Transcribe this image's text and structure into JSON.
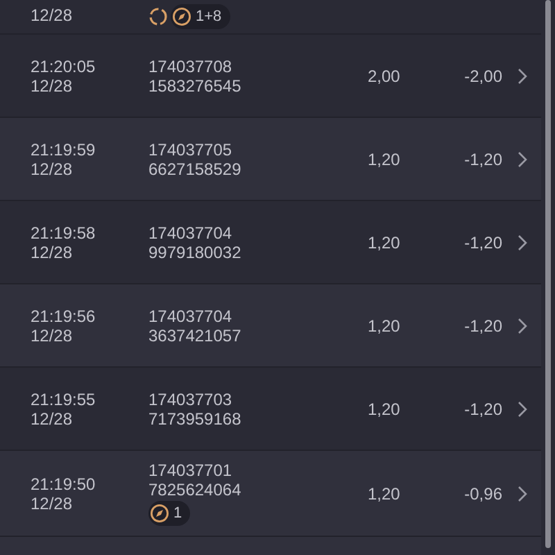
{
  "top_partial_row": {
    "date": "12/28",
    "badges": [
      {
        "kind": "refresh"
      },
      {
        "kind": "boost",
        "text": "1+8"
      }
    ]
  },
  "rows": [
    {
      "time": "21:20:05",
      "date": "12/28",
      "order_id": "174037708",
      "ticket": "1583276545",
      "amount": "2,00",
      "result": "-2,00",
      "badges": []
    },
    {
      "time": "21:19:59",
      "date": "12/28",
      "order_id": "174037705",
      "ticket": "6627158529",
      "amount": "1,20",
      "result": "-1,20",
      "badges": []
    },
    {
      "time": "21:19:58",
      "date": "12/28",
      "order_id": "174037704",
      "ticket": "9979180032",
      "amount": "1,20",
      "result": "-1,20",
      "badges": []
    },
    {
      "time": "21:19:56",
      "date": "12/28",
      "order_id": "174037704",
      "ticket": "3637421057",
      "amount": "1,20",
      "result": "-1,20",
      "badges": []
    },
    {
      "time": "21:19:55",
      "date": "12/28",
      "order_id": "174037703",
      "ticket": "7173959168",
      "amount": "1,20",
      "result": "-1,20",
      "badges": []
    },
    {
      "time": "21:19:50",
      "date": "12/28",
      "order_id": "174037701",
      "ticket": "7825624064",
      "amount": "1,20",
      "result": "-0,96",
      "badges": [
        {
          "kind": "boost",
          "text": "1"
        }
      ]
    }
  ]
}
